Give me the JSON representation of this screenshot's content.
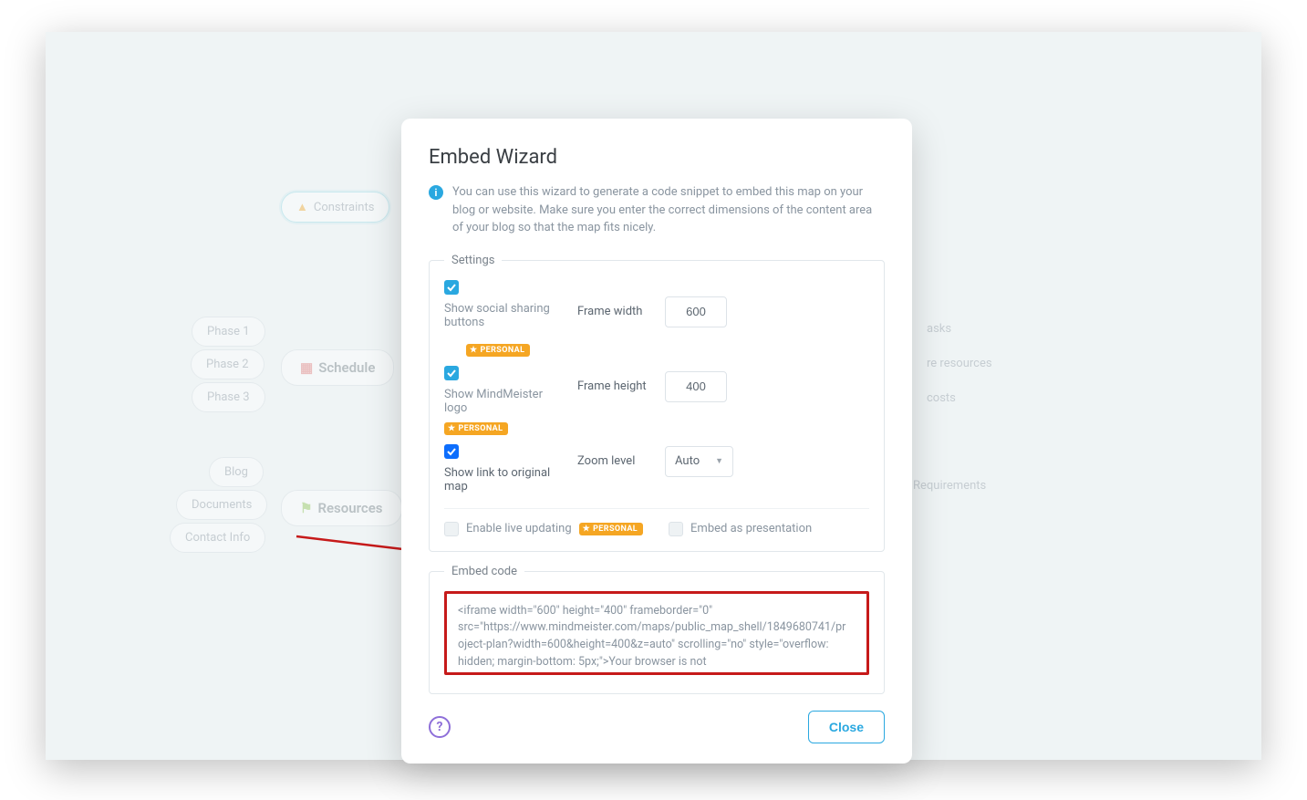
{
  "modal": {
    "title": "Embed Wizard",
    "info_text": "You can use this wizard to generate a code snippet to embed this map on your blog or website. Make sure you enter the correct dimensions of the content area of your blog so that the map fits nicely.",
    "settings_legend": "Settings",
    "labels": {
      "frame_width": "Frame width",
      "frame_height": "Frame height",
      "zoom_level": "Zoom level"
    },
    "values": {
      "frame_width": "600",
      "frame_height": "400",
      "zoom_level": "Auto"
    },
    "checks": {
      "social": "Show social sharing buttons",
      "logo": "Show MindMeister logo",
      "link": "Show link to original map",
      "live": "Enable live updating",
      "presentation": "Embed as presentation"
    },
    "badge": "PERSONAL",
    "embed_legend": "Embed code",
    "embed_code": "<iframe width=\"600\" height=\"400\" frameborder=\"0\" src=\"https://www.mindmeister.com/maps/public_map_shell/1849680741/project-plan?width=600&height=400&z=auto\" scrolling=\"no\" style=\"overflow: hidden; margin-bottom: 5px;\">Your browser is not",
    "close_label": "Close"
  },
  "mindmap": {
    "constraints": "Constraints",
    "schedule": "Schedule",
    "resources": "Resources",
    "phase1": "Phase 1",
    "phase2": "Phase 2",
    "phase3": "Phase 3",
    "blog": "Blog",
    "documents": "Documents",
    "contact": "Contact Info",
    "tasks": "asks",
    "res_right": "re resources",
    "costs": "costs",
    "requirements": "Requirements"
  }
}
